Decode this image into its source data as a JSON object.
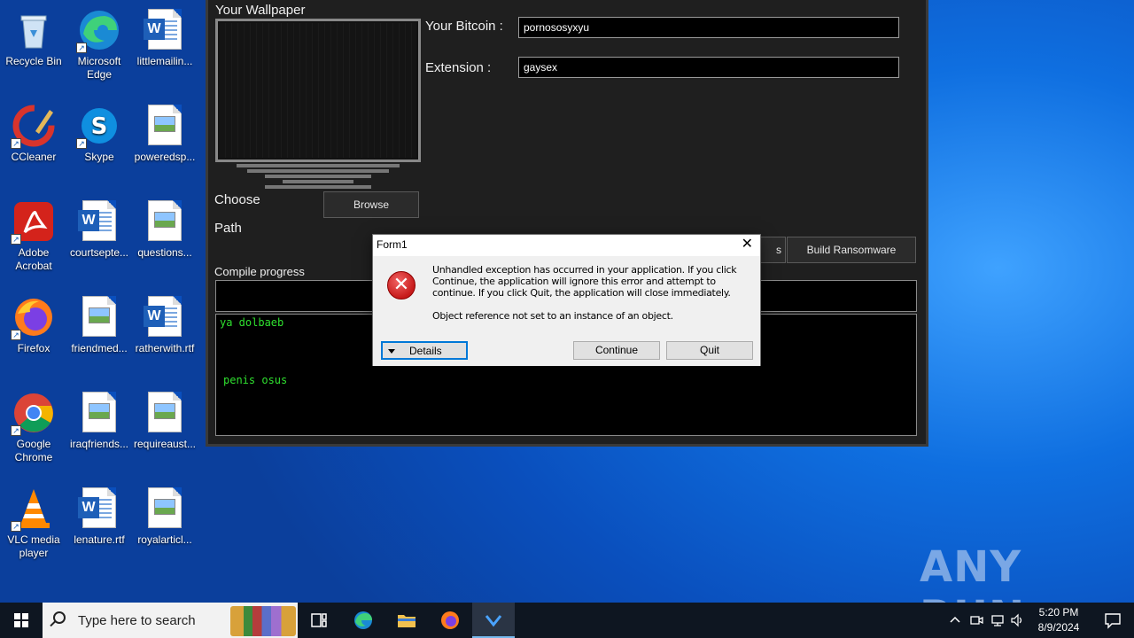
{
  "desktop": {
    "icons": [
      {
        "label": "Recycle Bin"
      },
      {
        "label": "Microsoft Edge"
      },
      {
        "label": "littlemailin..."
      },
      {
        "label": "CCleaner"
      },
      {
        "label": "Skype"
      },
      {
        "label": "poweredsp..."
      },
      {
        "label": "Adobe Acrobat"
      },
      {
        "label": "courtsepte..."
      },
      {
        "label": "questions..."
      },
      {
        "label": "Firefox"
      },
      {
        "label": "friendmed..."
      },
      {
        "label": "ratherwith.rtf"
      },
      {
        "label": "Google Chrome"
      },
      {
        "label": "iraqfriends..."
      },
      {
        "label": "requireaust..."
      },
      {
        "label": "VLC media player"
      },
      {
        "label": "lenature.rtf"
      },
      {
        "label": "royalarticl..."
      }
    ]
  },
  "builder": {
    "wallpaper_label": "Your Wallpaper",
    "bitcoin_label": "Your Bitcoin :",
    "bitcoin_value": "pornososyxyu",
    "extension_label": "Extension :",
    "extension_value": "gaysex",
    "choose_label": "Choose",
    "browse_label": "Browse",
    "path_label": "Path",
    "hidden_btn_label": "s",
    "build_label": "Build Ransomware",
    "compile_label": "Compile progress",
    "log_line_1": "ya dolbaeb",
    "log_line_2": "penis osus"
  },
  "dialog": {
    "title": "Form1",
    "message": "Unhandled exception has occurred in your application. If you click Continue, the application will ignore this error and attempt to continue. If you click Quit, the application will close immediately.",
    "detail": "Object reference not set to an instance of an object.",
    "details_label": "Details",
    "continue_label": "Continue",
    "quit_label": "Quit",
    "close_glyph": "✕",
    "error_glyph": "✕"
  },
  "taskbar": {
    "search_placeholder": "Type here to search",
    "time": "5:20 PM",
    "date": "8/9/2024"
  },
  "watermark": "ANY RUN",
  "colors": {
    "log_green": "#2fe02f",
    "dialog_accent": "#0078d7",
    "error_red": "#c61a1a"
  }
}
